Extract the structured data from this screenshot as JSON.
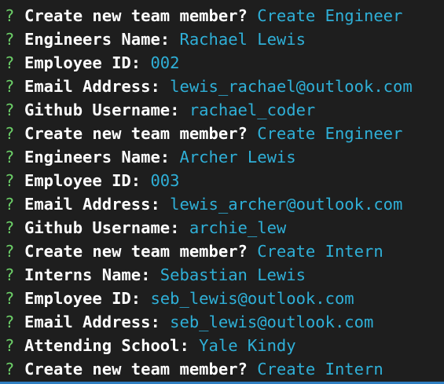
{
  "terminal": {
    "prompt_symbol": "?",
    "colors": {
      "background": "#1e1e1e",
      "prompt": "#6ccf68",
      "question": "#ffffff",
      "answer": "#2fb0d8",
      "bottom_bar": "#2f7fc1"
    },
    "lines": [
      {
        "question": "Create new team member?",
        "answer": "Create Engineer"
      },
      {
        "question": "Engineers Name:",
        "answer": "Rachael Lewis"
      },
      {
        "question": "Employee ID:",
        "answer": "002"
      },
      {
        "question": "Email Address:",
        "answer": "lewis_rachael@outlook.com"
      },
      {
        "question": "Github Username:",
        "answer": "rachael_coder"
      },
      {
        "question": "Create new team member?",
        "answer": "Create Engineer"
      },
      {
        "question": "Engineers Name:",
        "answer": "Archer Lewis"
      },
      {
        "question": "Employee ID:",
        "answer": "003"
      },
      {
        "question": "Email Address:",
        "answer": "lewis_archer@outlook.com"
      },
      {
        "question": "Github Username:",
        "answer": "archie_lew"
      },
      {
        "question": "Create new team member?",
        "answer": "Create Intern"
      },
      {
        "question": "Interns Name:",
        "answer": "Sebastian Lewis"
      },
      {
        "question": "Employee ID:",
        "answer": "seb_lewis@outlook.com"
      },
      {
        "question": "Email Address:",
        "answer": "seb_lewis@outlook.com"
      },
      {
        "question": "Attending School:",
        "answer": "Yale Kindy"
      },
      {
        "question": "Create new team member?",
        "answer": "Create Intern"
      }
    ]
  }
}
